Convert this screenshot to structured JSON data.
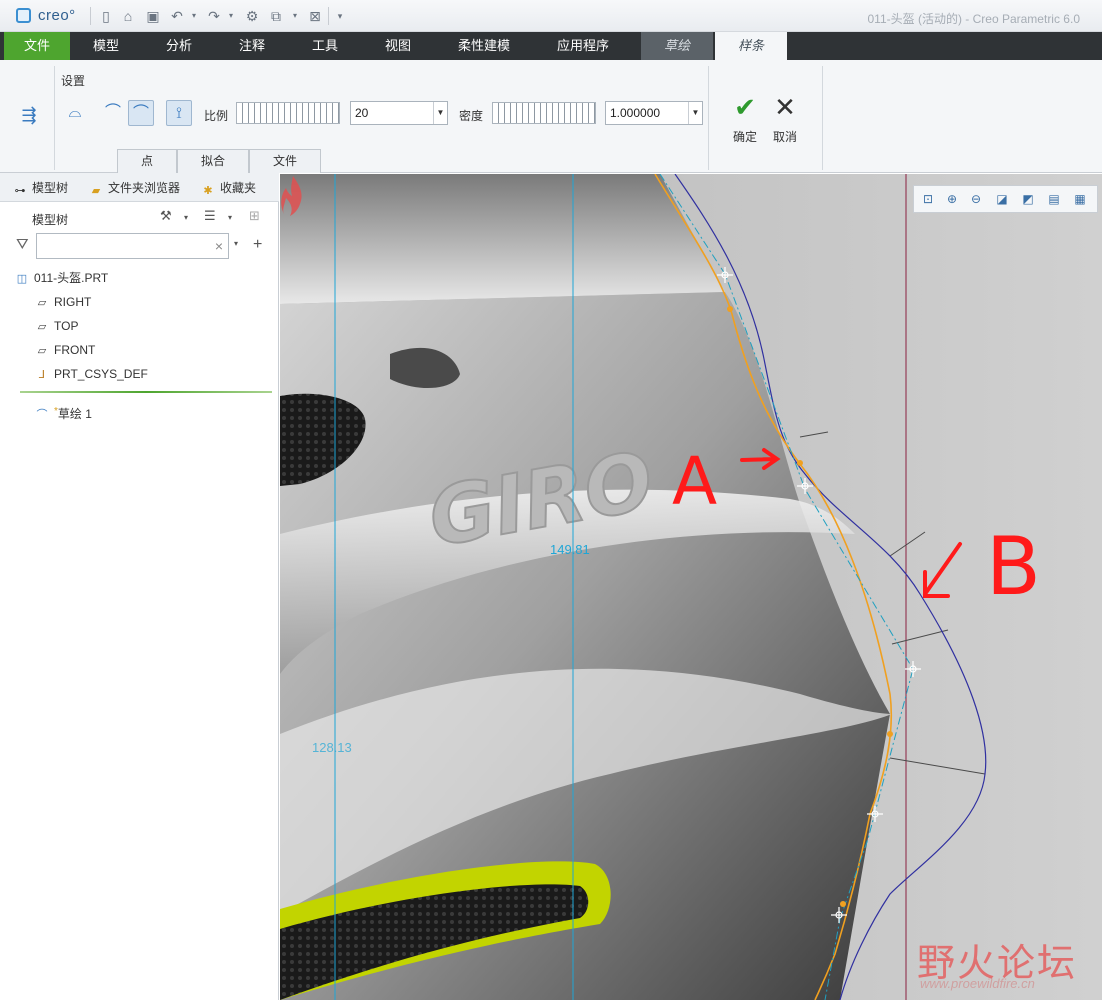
{
  "app": {
    "logo_text": "creo°",
    "window_title": "011-头盔 (活动的) - Creo Parametric 6.0"
  },
  "quick_access": [
    "new-icon",
    "open-icon",
    "save-icon",
    "undo-icon",
    "redo-icon",
    "regenerate-icon",
    "windows-icon",
    "close-window-icon",
    "customize-icon"
  ],
  "ribbon_tabs": [
    {
      "label": "文件"
    },
    {
      "label": "模型"
    },
    {
      "label": "分析"
    },
    {
      "label": "注释"
    },
    {
      "label": "工具"
    },
    {
      "label": "视图"
    },
    {
      "label": "柔性建模"
    },
    {
      "label": "应用程序"
    },
    {
      "label": "草绘"
    },
    {
      "label": "样条"
    }
  ],
  "ribbon": {
    "group_label": "设置",
    "scale_label": "比例",
    "scale_value": "20",
    "density_label": "密度",
    "density_value": "1.000000",
    "subtabs": [
      "点",
      "拟合",
      "文件"
    ],
    "ok_label": "确定",
    "cancel_label": "取消"
  },
  "nav_tabs": [
    "模型树",
    "文件夹浏览器",
    "收藏夹"
  ],
  "model_tree": {
    "header": "模型树",
    "search_placeholder": "",
    "items": [
      {
        "label": "011-头盔.PRT",
        "icon": "part-icon"
      },
      {
        "label": "RIGHT",
        "icon": "datum-plane-icon"
      },
      {
        "label": "TOP",
        "icon": "datum-plane-icon"
      },
      {
        "label": "FRONT",
        "icon": "datum-plane-icon"
      },
      {
        "label": "PRT_CSYS_DEF",
        "icon": "csys-icon"
      },
      {
        "label": "草绘 1",
        "icon": "sketch-icon"
      }
    ]
  },
  "viewport": {
    "brand_text": "GIRO",
    "dimensions": [
      "149.81",
      "128.13"
    ],
    "annotations": [
      "A",
      "B"
    ],
    "watermark": "野火论坛",
    "watermark_url": "www.proewildfire.cn",
    "colors": {
      "dimension": "#1fa6d6",
      "annotation": "#ff1a1a",
      "curve_orange": "#f0a020",
      "curve_blue": "#3030a0",
      "construction": "#20a0c0"
    }
  }
}
